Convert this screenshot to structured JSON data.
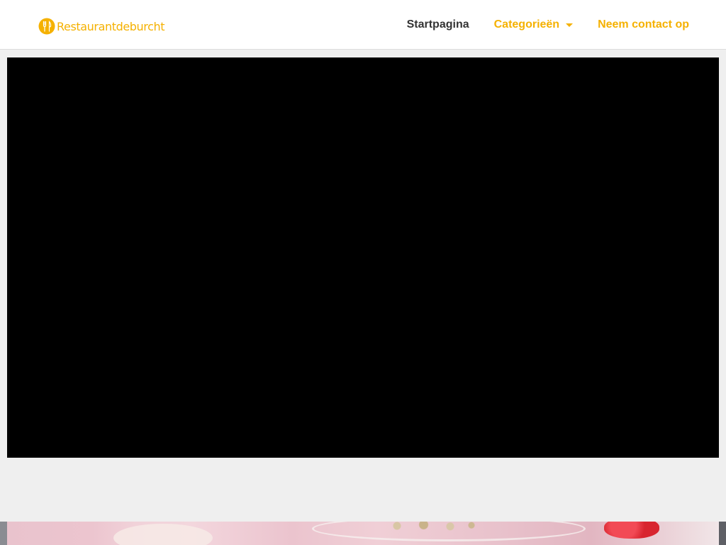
{
  "header": {
    "logo_text": "Restaurantdeburcht",
    "nav": {
      "home": "Startpagina",
      "categories": "Categorieën",
      "contact": "Neem contact op"
    }
  },
  "colors": {
    "accent": "#f5b100",
    "nav_text": "#333333",
    "page_background": "#efefef",
    "video_background": "#000000"
  },
  "icons": {
    "logo": "utensils-circle-icon",
    "dropdown": "caret-down-icon"
  }
}
